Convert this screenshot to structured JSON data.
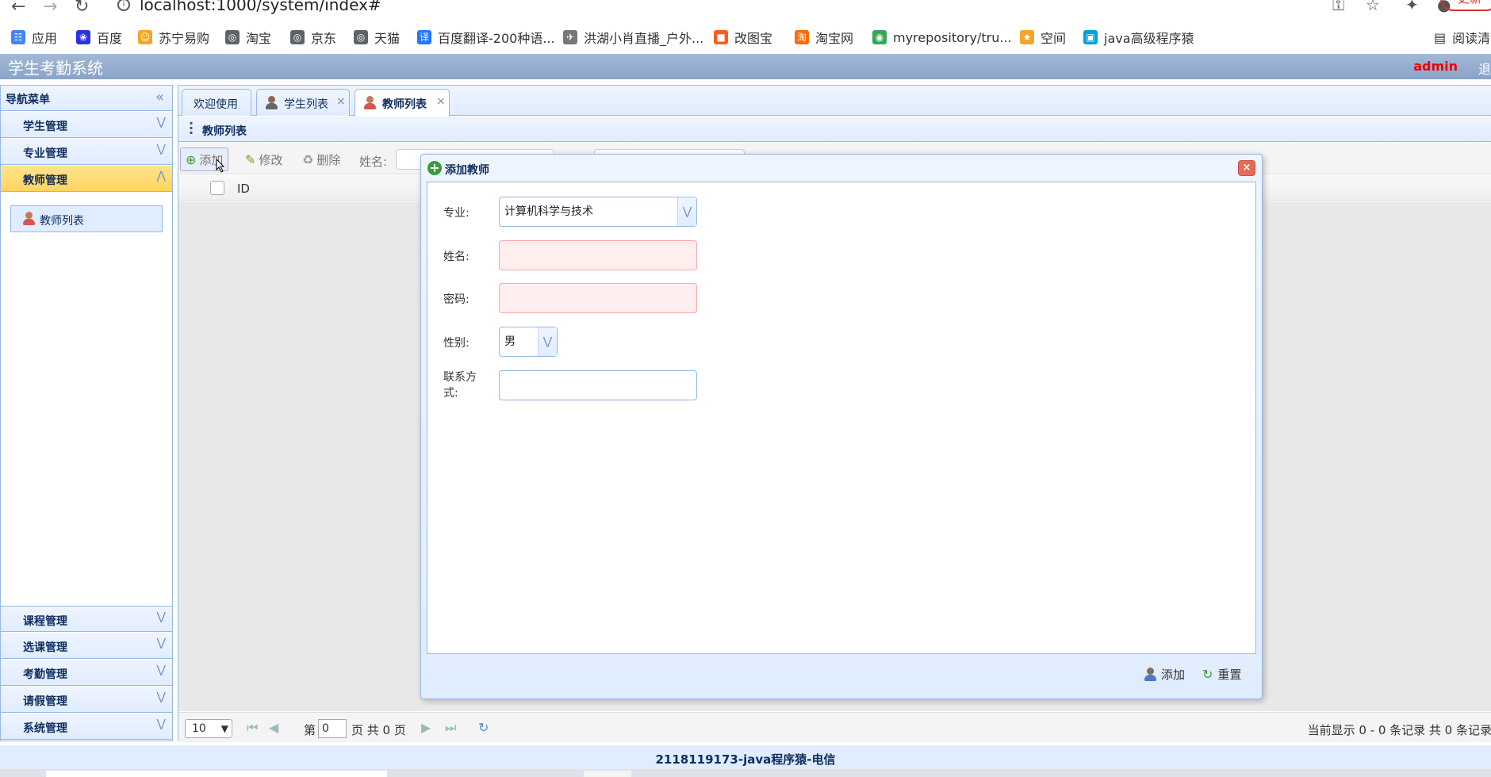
{
  "browser": {
    "url": "localhost:1000/system/index#",
    "update_label": "更新",
    "bookmarks": [
      {
        "label": "应用",
        "icon": "apps-grid-icon",
        "color": "#4285f4"
      },
      {
        "label": "百度",
        "icon": "paw-icon",
        "color": "#2932e1"
      },
      {
        "label": "苏宁易购",
        "icon": "lion-icon",
        "color": "#f5a623"
      },
      {
        "label": "淘宝",
        "icon": "globe-icon",
        "color": "#5f6368"
      },
      {
        "label": "京东",
        "icon": "globe-icon",
        "color": "#5f6368"
      },
      {
        "label": "天猫",
        "icon": "globe-icon",
        "color": "#5f6368"
      },
      {
        "label": "百度翻译-200种语...",
        "icon": "translate-icon",
        "color": "#2575ff"
      },
      {
        "label": "洪湖小肖直播_户外...",
        "icon": "bird-icon",
        "color": "#777777"
      },
      {
        "label": "改图宝",
        "icon": "square-icon",
        "color": "#ff5a1f"
      },
      {
        "label": "淘宝网",
        "icon": "tao-icon",
        "color": "#ff6a00"
      },
      {
        "label": "myrepository/tru...",
        "icon": "chrome-icon",
        "color": "#34a853"
      },
      {
        "label": "空间",
        "icon": "qzone-icon",
        "color": "#f5a623"
      },
      {
        "label": "java高级程序猿",
        "icon": "tv-icon",
        "color": "#00a1d6"
      }
    ],
    "reading_list": "阅读清"
  },
  "app": {
    "title": "学生考勤系统",
    "user": "admin",
    "logout": "退出"
  },
  "sidebar": {
    "title": "导航菜单",
    "items_top": [
      {
        "label": "学生管理"
      },
      {
        "label": "专业管理"
      },
      {
        "label": "教师管理",
        "active": true
      }
    ],
    "sub_item": "教师列表",
    "items_bottom": [
      {
        "label": "课程管理"
      },
      {
        "label": "选课管理"
      },
      {
        "label": "考勤管理"
      },
      {
        "label": "请假管理"
      },
      {
        "label": "系统管理"
      }
    ]
  },
  "tabs": [
    {
      "label": "欢迎使用",
      "closable": false
    },
    {
      "label": "学生列表",
      "closable": true
    },
    {
      "label": "教师列表",
      "closable": true,
      "selected": true
    }
  ],
  "panel": {
    "title": "教师列表",
    "toolbar": {
      "add": "添加",
      "edit": "修改",
      "delete": "删除",
      "name_label": "姓名:"
    },
    "grid": {
      "columns": [
        "ID"
      ]
    },
    "pager": {
      "page_size": "10",
      "page_prefix": "第",
      "page_value": "0",
      "page_suffix": "页 共 0 页",
      "info": "当前显示 0 - 0 条记录 共 0 条记录"
    }
  },
  "dialog": {
    "title": "添加教师",
    "fields": {
      "major_label": "专业:",
      "major_value": "计算机科学与技术",
      "name_label": "姓名:",
      "password_label": "密码:",
      "gender_label": "性别:",
      "gender_value": "男",
      "contact_label": "联系方式:"
    },
    "add_button": "添加",
    "reset_button": "重置"
  },
  "footer": {
    "text": "2118119173-java程序猿-电信"
  }
}
